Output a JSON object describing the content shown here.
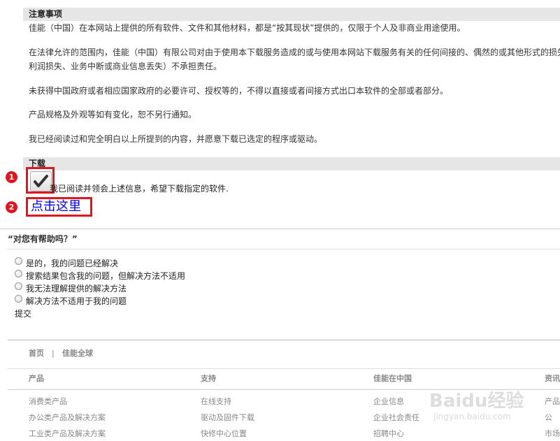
{
  "notice": {
    "title": "注意事项",
    "paragraphs": [
      "佳能（中国）在本网站上提供的所有软件、文件和其他材料，都是“按其现状”提供的，仅限于个人及非商业用途使用。",
      "在法律允许的范围内，佳能（中国）有限公司对由于使用本下载服务造成的或与使用本网站下载服务有关的任何间接的、偶然的或其他形式的损失",
      "利润损失、业务中断或商业信息丢失）不承担责任。",
      "未获得中国政府或者相应国家政府的必要许可、授权等的，不得以直接或者间接方式出口本软件的全部或者部分。",
      "产品规格及外观等如有变化，恕不另行通知。",
      "我已经阅读过和完全明白以上所提到的内容，并愿意下载已选定的程序或驱动。"
    ]
  },
  "download": {
    "title": "下载",
    "agree_label": "我已阅读并领会上述信息，希望下载指定的软件.",
    "agree_checked": true,
    "link_label": "点击这里"
  },
  "annotations": {
    "step1": "1",
    "step2": "2",
    "accent": "#e2141e"
  },
  "feedback": {
    "title": "“对您有帮助吗？”",
    "options": [
      "是的，我的问题已经解决",
      "搜索结果包含我的问题，但解决方法不适用",
      "我无法理解提供的解决方法",
      "解决方法不适用于我的问题"
    ],
    "submit_label": "提交"
  },
  "footer": {
    "breadcrumb": {
      "home": "首页",
      "separator": "|",
      "global": "佳能全球"
    },
    "columns": [
      {
        "heading": "产品",
        "links": [
          "消费类产品",
          "办公类产品及解决方案",
          "工业类产品及解决方案"
        ]
      },
      {
        "heading": "支持",
        "links": [
          "在线支持",
          "驱动及固件下载",
          "快修中心位置"
        ]
      },
      {
        "heading": "佳能在中国",
        "links": [
          "企业信息",
          "企业社会责任",
          "招聘中心"
        ]
      },
      {
        "heading": "资讯",
        "links": [
          "产品",
          "公",
          "市场"
        ]
      }
    ]
  },
  "watermark": {
    "brand": "Baidu经验",
    "url": "jingyan.baidu.com"
  }
}
